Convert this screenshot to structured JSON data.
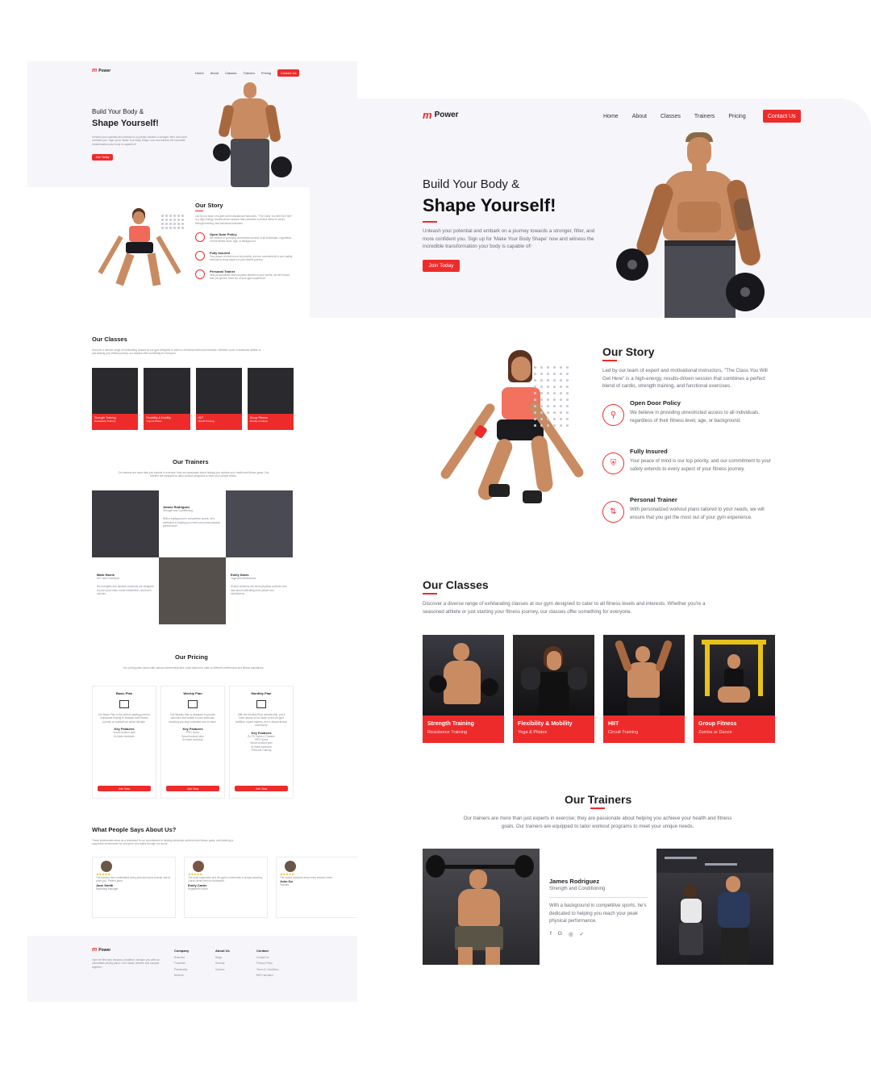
{
  "brand": {
    "name": "Power",
    "mark": "m"
  },
  "nav": {
    "items": [
      "Home",
      "About",
      "Classes",
      "Trainers",
      "Pricing"
    ],
    "cta": "Contact Us"
  },
  "hero": {
    "kicker": "Build Your Body &",
    "title": "Shape Yourself!",
    "description": "Unleash your potential and embark on a journey towards a stronger, fitter, and more confident you. Sign up for 'Make Your Body Shape' now and witness the incredible transformation your body is capable of!",
    "cta": "Join Today"
  },
  "story": {
    "title": "Our Story",
    "intro": "Led by our team of expert and motivational instructors, \"The Class You Will Get Here\" is a high-energy, results-driven session that combines a perfect blend of cardio, strength training, and functional exercises.",
    "features": [
      {
        "icon": "open-door-icon",
        "title": "Open Door Policy",
        "desc": "We believe in providing unrestricted access to all individuals, regardless of their fitness level, age, or background."
      },
      {
        "icon": "shield-icon",
        "title": "Fully Insured",
        "desc": "Your peace of mind is our top priority, and our commitment to your safety extends to every aspect of your fitness journey."
      },
      {
        "icon": "trainer-icon",
        "title": "Personal Trainer",
        "desc": "With personalized workout plans tailored to your needs, we will ensure that you get the most out of your gym experience."
      }
    ]
  },
  "classes": {
    "title": "Our Classes",
    "desc": "Discover a diverse range of exhilarating classes at our gym designed to cater to all fitness levels and interests. Whether you're a seasoned athlete or just starting your fitness journey, our classes offer something for everyone.",
    "items": [
      {
        "title": "Strength Training",
        "sub": "Resistance Training"
      },
      {
        "title": "Flexibility & Mobility",
        "sub": "Yoga & Pilates"
      },
      {
        "title": "HIIT",
        "sub": "Circuit Training"
      },
      {
        "title": "Group Fitness",
        "sub": "Zumba or Dance"
      }
    ]
  },
  "trainers": {
    "title": "Our Trainers",
    "desc": "Our trainers are more than just experts in exercise; they are passionate about helping you achieve your health and fitness goals. Our trainers are equipped to tailor workout programs to meet your unique needs.",
    "featured": {
      "name": "James Rodriguez",
      "role": "Strength and Conditioning",
      "bio": "With a background in competitive sports, he's dedicated to helping you reach your peak physical performance."
    },
    "others": [
      {
        "name": "Mark Harris",
        "role": "HIIT and Functional",
        "bio": "His energetic and dynamic workouts are designed to push your limits, boost metabolism, and torch calories."
      },
      {
        "name": "Emily Davis",
        "role": "Yoga and Mindfulness",
        "bio": "Emily's sessions are about physical postures and also about cultivating inner peace and mindfulness."
      }
    ]
  },
  "pricing": {
    "title": "Our Pricing",
    "desc": "Our pricing plan comes with various membership tiers, each tailored to cater to different preferences and fitness aspirations.",
    "plans": [
      {
        "name": "Basic Plan",
        "desc": "Our Basic Plan is the perfect starting point for individuals looking to kickstart their fitness journey or maintain an active lifestyle.",
        "features_title": "Key Features",
        "features": [
          "Smart workout plan",
          "At home workouts"
        ],
        "cta": "Join Now"
      },
      {
        "name": "Weekly Plan",
        "desc": "Our Weekly Plan is designed to provide structure and variety to your workouts, ensuring you stay motivated and on track.",
        "features_title": "Key Features",
        "features": [
          "PRO Gyms",
          "Smart workout plan",
          "At home workouts"
        ],
        "cta": "Join Now"
      },
      {
        "name": "Monthly Plan",
        "desc": "With the Monthly Plan membership, you'll have access to our state-of-the-art gym facilities, expert trainers, and a vibrant fitness community.",
        "features_title": "Key Features",
        "features": [
          "ELITE Gyms & Classes",
          "PRO Gyms",
          "Smart workout plan",
          "At home workouts",
          "Personal Training"
        ],
        "cta": "Join Now"
      }
    ]
  },
  "testimonials": {
    "title": "What People Says About Us?",
    "desc": "These testimonials serve as a testament to our commitment to helping individuals achieve their fitness goals, and fostering a supportive environment for everyone who walks through our doors.",
    "items": [
      {
        "stars": "★★★★★",
        "text": "The trainers here understand every plan and know exactly how to push you. Perfect pace.",
        "name": "Jane Smith",
        "role": "Marketing Manager"
      },
      {
        "stars": "★★★★★",
        "text": "The most supportive and the gym's community is simply amazing. I have never been so motivated.",
        "name": "Emily Carter",
        "role": "Registered Nurse"
      },
      {
        "stars": "★★★★★",
        "text": "The varied workouts keep every session fresh.",
        "name": "John Do",
        "role": "Teacher"
      }
    ]
  },
  "footer": {
    "tagline": "Take the first step towards a healthier, stronger you with our unbeatable pricing plans. Let's sweat, achieve and conquer together!",
    "columns": [
      {
        "title": "Company",
        "links": [
          "Business",
          "Franchise",
          "Partnership",
          "Network"
        ]
      },
      {
        "title": "About Us",
        "links": [
          "Blogs",
          "Security",
          "Careers"
        ]
      },
      {
        "title": "Contact",
        "links": [
          "Contact Us",
          "Privacy Policy",
          "Terms & Conditions",
          "BMI Calculator"
        ]
      }
    ],
    "social": [
      "f",
      "G",
      "◎",
      "♥"
    ]
  },
  "colors": {
    "accent": "#ee2b2b",
    "hero_bg": "#f6f6fa",
    "text": "#1d1d1f",
    "muted": "#6a6a76"
  }
}
